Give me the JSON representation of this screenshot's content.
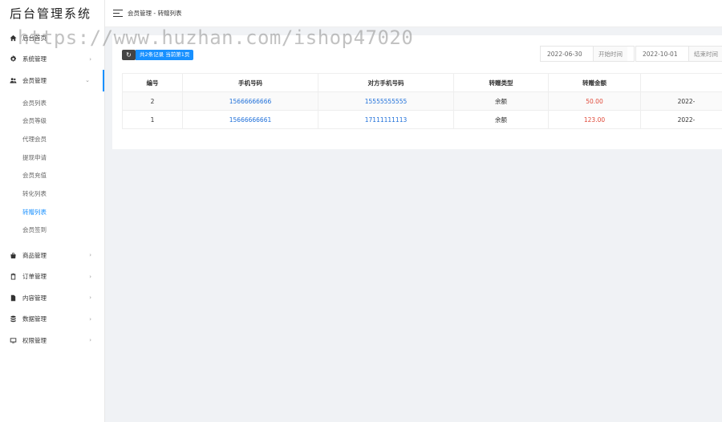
{
  "brand": "后台管理系统",
  "watermark": "https://www.huzhan.com/ishop47020",
  "header": {
    "breadcrumb": "会员管理 - 转赠列表"
  },
  "sidebar": {
    "top_items": [
      {
        "label": "后台首页",
        "icon": "home-icon"
      },
      {
        "label": "系统管理",
        "icon": "gear-icon",
        "chevron": "›"
      }
    ],
    "open_group": {
      "label": "会员管理",
      "icon": "users-icon",
      "chevron": "⌄"
    },
    "submenu": [
      "会员列表",
      "会员等级",
      "代理会员",
      "提现申请",
      "会员充值",
      "转化列表",
      "转赠列表",
      "会员签到"
    ],
    "active_sub": "转赠列表",
    "bottom_items": [
      {
        "label": "商品管理",
        "icon": "bag-icon",
        "chevron": "›"
      },
      {
        "label": "订单管理",
        "icon": "clipboard-icon",
        "chevron": "›"
      },
      {
        "label": "内容管理",
        "icon": "document-icon",
        "chevron": "›"
      },
      {
        "label": "数据管理",
        "icon": "database-icon",
        "chevron": "›"
      },
      {
        "label": "权限管理",
        "icon": "screen-icon",
        "chevron": "›"
      }
    ]
  },
  "toolbar": {
    "refresh_icon": "↻",
    "count_text": "共2条记录 当前第1页",
    "start_date": "2022-06-30",
    "start_label": "开始时间",
    "end_date": "2022-10-01",
    "end_label": "结束时间"
  },
  "table": {
    "columns": [
      "编号",
      "手机号码",
      "对方手机号码",
      "转赠类型",
      "转赠金额",
      ""
    ],
    "rows": [
      [
        "2",
        "15666666666",
        "15555555555",
        "余额",
        "50.00",
        "2022-"
      ],
      [
        "1",
        "15666666661",
        "17111111113",
        "余额",
        "123.00",
        "2022-"
      ]
    ]
  },
  "colors": {
    "accent": "#1890ff",
    "link": "#1e6fd9",
    "amount": "#e04a3a"
  }
}
